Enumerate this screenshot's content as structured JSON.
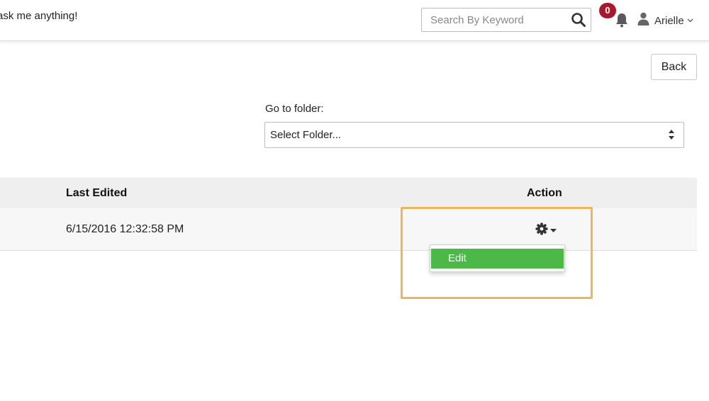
{
  "header": {
    "tagline": "ask me anything!",
    "search": {
      "placeholder": "Search By Keyword",
      "value": ""
    },
    "notifications": {
      "count": "0",
      "icon": "bell-icon"
    },
    "user": {
      "name": "Arielle",
      "icon": "user-icon"
    }
  },
  "toolbar": {
    "back_label": "Back"
  },
  "folder": {
    "label": "Go to folder:",
    "selected": "Select Folder..."
  },
  "table": {
    "columns": [
      "Last Edited",
      "Action"
    ],
    "rows": [
      {
        "last_edited": "6/15/2016 12:32:58 PM"
      }
    ]
  },
  "action_menu": {
    "items": [
      "Edit"
    ]
  },
  "colors": {
    "badge": "#a8192e",
    "menu_highlight": "#4cb848",
    "callout_border": "#efb55a"
  }
}
